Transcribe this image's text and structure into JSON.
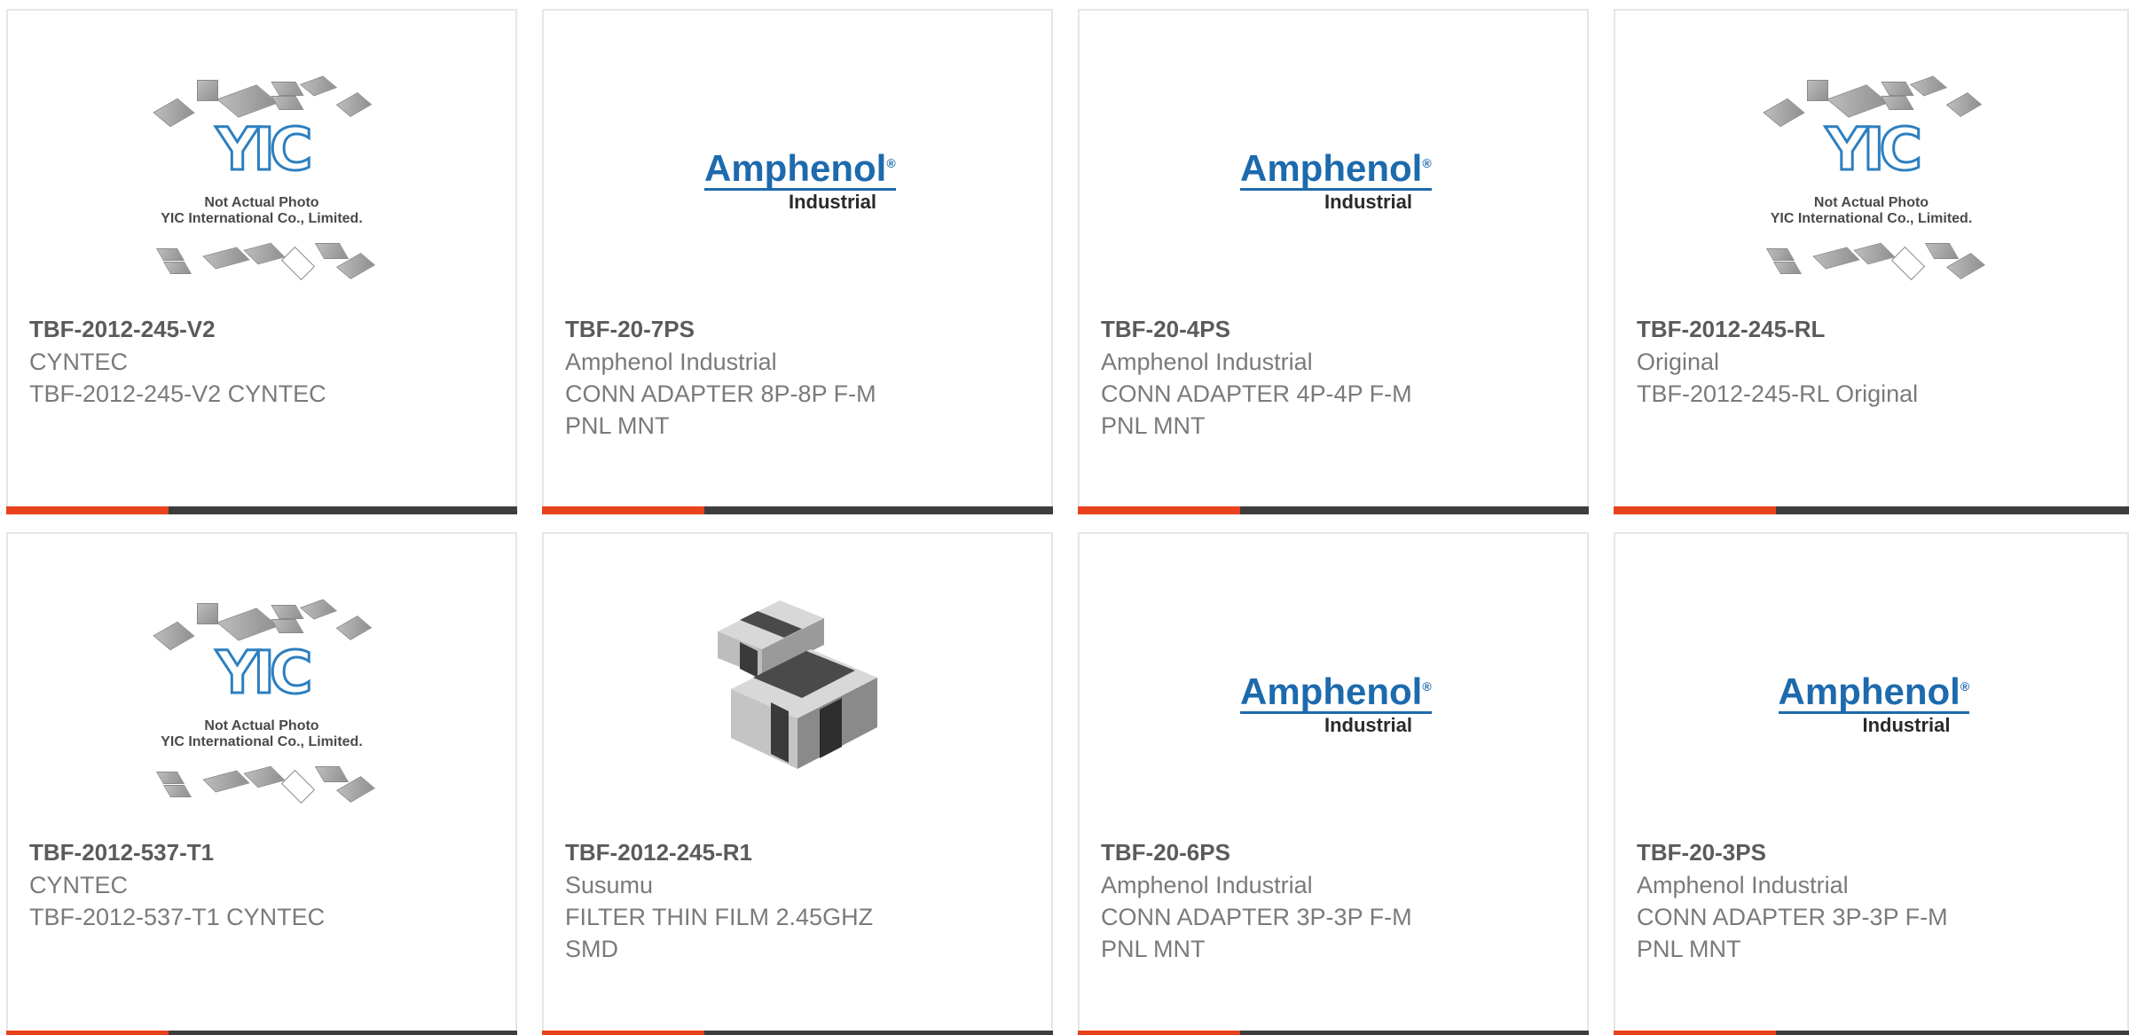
{
  "products": [
    {
      "image": "yic-placeholder",
      "part_number": "TBF-2012-245-V2",
      "manufacturer": "CYNTEC",
      "description": "TBF-2012-245-V2 CYNTEC"
    },
    {
      "image": "amphenol-logo",
      "part_number": "TBF-20-7PS",
      "manufacturer": "Amphenol Industrial",
      "description": "CONN ADAPTER 8P-8P F-M PNL MNT"
    },
    {
      "image": "amphenol-logo",
      "part_number": "TBF-20-4PS",
      "manufacturer": "Amphenol Industrial",
      "description": "CONN ADAPTER 4P-4P F-M PNL MNT"
    },
    {
      "image": "yic-placeholder",
      "part_number": "TBF-2012-245-RL",
      "manufacturer": "Original",
      "description": "TBF-2012-245-RL Original"
    },
    {
      "image": "yic-placeholder",
      "part_number": "TBF-2012-537-T1",
      "manufacturer": "CYNTEC",
      "description": "TBF-2012-537-T1 CYNTEC"
    },
    {
      "image": "susumu-chip",
      "part_number": "TBF-2012-245-R1",
      "manufacturer": "Susumu",
      "description": "FILTER THIN FILM 2.45GHZ SMD"
    },
    {
      "image": "amphenol-logo",
      "part_number": "TBF-20-6PS",
      "manufacturer": "Amphenol Industrial",
      "description": "CONN ADAPTER 3P-3P F-M PNL MNT"
    },
    {
      "image": "amphenol-logo",
      "part_number": "TBF-20-3PS",
      "manufacturer": "Amphenol Industrial",
      "description": "CONN ADAPTER 3P-3P F-M PNL MNT"
    }
  ],
  "placeholder": {
    "logo_text": "YIC",
    "caption_line1": "Not Actual Photo",
    "caption_line2": "YIC International Co., Limited."
  },
  "amphenol_logo": {
    "brand": "Amphenol",
    "registered": "®",
    "sub": "Industrial"
  },
  "colors": {
    "accent": "#e8421c",
    "bar": "#3d3d3d",
    "part_number": "#5b5b5b",
    "text": "#7a7a7a",
    "amphenol_blue": "#1d6aad",
    "yic_blue": "#2c7fc0"
  }
}
